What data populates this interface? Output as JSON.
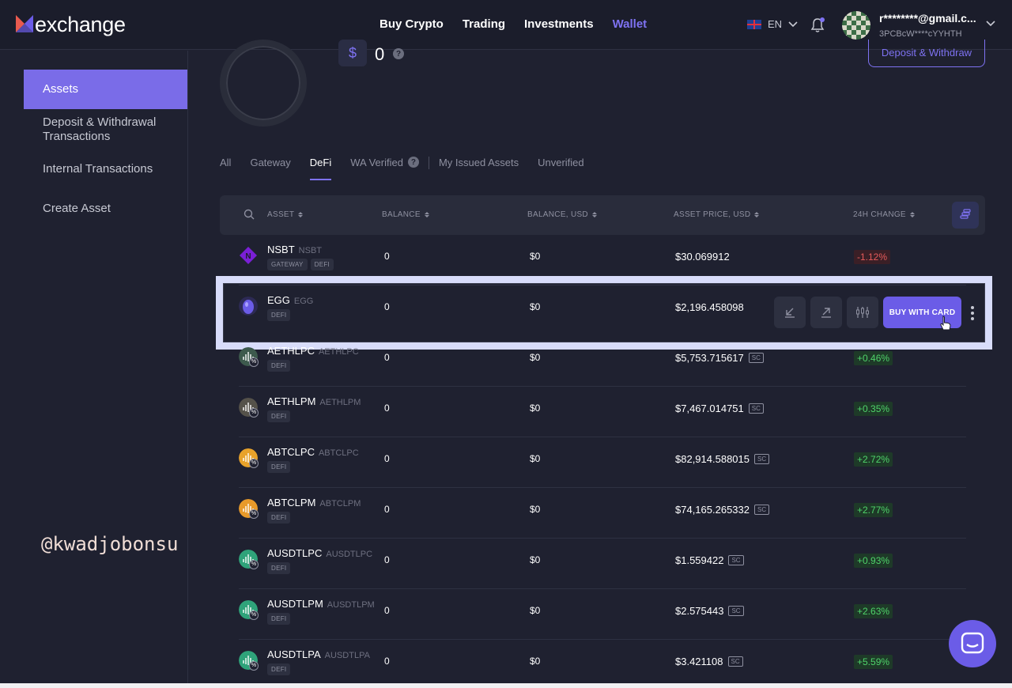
{
  "header": {
    "logo_text": "exchange",
    "nav": [
      {
        "label": "Buy Crypto"
      },
      {
        "label": "Trading"
      },
      {
        "label": "Investments"
      },
      {
        "label": "Wallet",
        "active": true
      }
    ],
    "language": "EN",
    "user_email": "r********@gmail.c...",
    "user_address": "3PCBcW****cYYHTH"
  },
  "sidebar": {
    "items": [
      {
        "label": "Assets",
        "active": true
      },
      {
        "label": "Deposit & Withdrawal Transactions"
      },
      {
        "label": "Internal Transactions"
      },
      {
        "label": "Create Asset"
      }
    ]
  },
  "watermark": "@kwadjobonsu",
  "summary": {
    "currency_symbol": "$",
    "total_value": "0",
    "help_icon": "?",
    "deposit_withdraw_label": "Deposit & Withdraw"
  },
  "tabs": [
    {
      "label": "All"
    },
    {
      "label": "Gateway"
    },
    {
      "label": "DeFi",
      "active": true
    },
    {
      "label": "WA Verified",
      "help": "?"
    },
    {
      "label": "My Issued Assets"
    },
    {
      "label": "Unverified"
    }
  ],
  "table": {
    "columns": [
      "ASSET",
      "BALANCE",
      "BALANCE, USD",
      "ASSET PRICE, USD",
      "24H CHANGE"
    ],
    "rows": [
      {
        "name": "NSBT",
        "ticker": "NSBT",
        "tags": [
          "GATEWAY",
          "DEFI"
        ],
        "balance": "0",
        "balance_usd": "$0",
        "price": "$30.069912",
        "sc": "",
        "change": "-1.12%",
        "change_dir": "neg",
        "icon": "nsbt-icon",
        "color": "#7a1fd6"
      },
      {
        "name": "EGG",
        "ticker": "EGG",
        "tags": [
          "DEFI"
        ],
        "balance": "0",
        "balance_usd": "$0",
        "price": "$2,196.458098",
        "sc": "",
        "change": "",
        "change_dir": "",
        "icon": "egg-icon",
        "color": "#6b5ce7"
      },
      {
        "name": "AETHLPC",
        "ticker": "AETHLPC",
        "tags": [
          "DEFI"
        ],
        "balance": "0",
        "balance_usd": "$0",
        "price": "$5,753.715617",
        "sc": "SC",
        "change": "+0.46%",
        "change_dir": "pos",
        "icon": "lp-token-icon",
        "color": "#3d5a4d"
      },
      {
        "name": "AETHLPM",
        "ticker": "AETHLPM",
        "tags": [
          "DEFI"
        ],
        "balance": "0",
        "balance_usd": "$0",
        "price": "$7,467.014751",
        "sc": "SC",
        "change": "+0.35%",
        "change_dir": "pos",
        "icon": "lp-token-icon",
        "color": "#55524a"
      },
      {
        "name": "ABTCLPC",
        "ticker": "ABTCLPC",
        "tags": [
          "DEFI"
        ],
        "balance": "0",
        "balance_usd": "$0",
        "price": "$82,914.588015",
        "sc": "SC",
        "change": "+2.72%",
        "change_dir": "pos",
        "icon": "lp-token-icon",
        "color": "#e8a22a"
      },
      {
        "name": "ABTCLPM",
        "ticker": "ABTCLPM",
        "tags": [
          "DEFI"
        ],
        "balance": "0",
        "balance_usd": "$0",
        "price": "$74,165.265332",
        "sc": "SC",
        "change": "+2.77%",
        "change_dir": "pos",
        "icon": "lp-token-icon",
        "color": "#e89a2a"
      },
      {
        "name": "AUSDTLPC",
        "ticker": "AUSDTLPC",
        "tags": [
          "DEFI"
        ],
        "balance": "0",
        "balance_usd": "$0",
        "price": "$1.559422",
        "sc": "SC",
        "change": "+0.93%",
        "change_dir": "pos",
        "icon": "lp-token-icon",
        "color": "#2fa37a"
      },
      {
        "name": "AUSDTLPM",
        "ticker": "AUSDTLPM",
        "tags": [
          "DEFI"
        ],
        "balance": "0",
        "balance_usd": "$0",
        "price": "$2.575443",
        "sc": "SC",
        "change": "+2.63%",
        "change_dir": "pos",
        "icon": "lp-token-icon",
        "color": "#2fa37a"
      },
      {
        "name": "AUSDTLPA",
        "ticker": "AUSDTLPA",
        "tags": [
          "DEFI"
        ],
        "balance": "0",
        "balance_usd": "$0",
        "price": "$3.421108",
        "sc": "SC",
        "change": "+5.59%",
        "change_dir": "pos",
        "icon": "lp-token-icon",
        "color": "#2fa37a"
      }
    ],
    "buy_with_card_label": "BUY WITH CARD"
  },
  "colors": {
    "accent": "#7e72f2",
    "background": "#1f2130",
    "positive": "#4fd36a",
    "negative": "#e65b5b"
  }
}
